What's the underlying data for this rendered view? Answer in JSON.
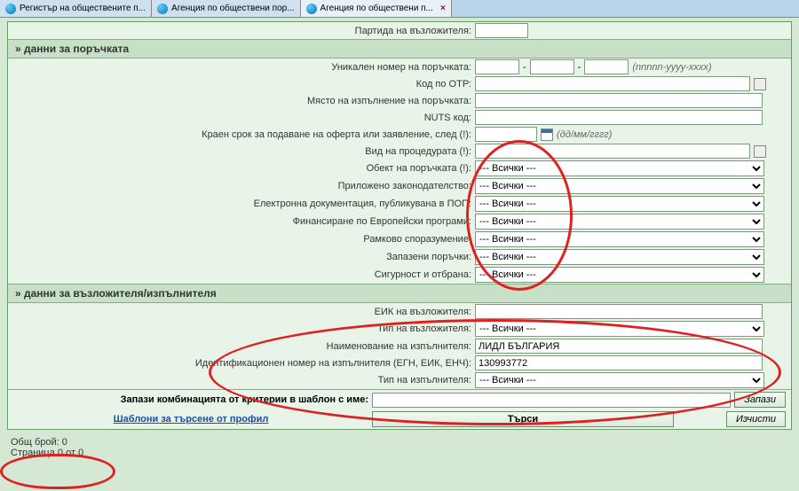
{
  "tabs": [
    {
      "label": "Регистър на обществените п..."
    },
    {
      "label": "Агенция по обществени пор..."
    },
    {
      "label": "Агенция по обществени п...",
      "active": true
    }
  ],
  "top": {
    "label_party": "Партида на възложителя:"
  },
  "section_order": "» данни за поръчката",
  "order": {
    "label_unique": "Уникален номер на поръчката:",
    "hint_unique": "(nnnnn-yyyy-xxxx)",
    "label_otp": "Код по ОТР:",
    "label_place": "Място на изпълнение на поръчката:",
    "label_nuts": "NUTS код:",
    "label_deadline": "Краен срок за подаване на оферта или заявление, след (!):",
    "hint_date": "(дд/мм/гггг)",
    "label_proc_type": "Вид на процедурата (!):",
    "label_object": "Обект на поръчката (!):",
    "label_legislation": "Приложено законодателство:",
    "label_edoc": "Електронна документация, публикувана в ПОП:",
    "label_eu_fin": "Финансиране по Европейски програми:",
    "label_framework": "Рамково споразумение:",
    "label_reserved": "Запазени поръчки:",
    "label_security": "Сигурност и отбрана:",
    "opt_all": "--- Всички ---"
  },
  "section_party": "» данни за възложителя/изпълнителя",
  "party": {
    "label_eik": "ЕИК на възложителя:",
    "label_type": "Тип на възложителя:",
    "label_exec_name": "Наименование на изпълнителя:",
    "exec_name_value": "ЛИДЛ БЪЛГАРИЯ",
    "label_exec_id": "Идентификационен номер на изпълнителя (ЕГН, ЕИК, ЕНЧ):",
    "exec_id_value": "130993772",
    "label_exec_type": "Тип на изпълнителя:",
    "opt_all": "--- Всички ---"
  },
  "template_save_label": "Запази комбинацията от критерии в шаблон с име:",
  "btn_save": "Запази",
  "link_templates": "Шаблони за търсене от профил",
  "btn_search": "Търси",
  "btn_clear": "Изчисти",
  "totals_count": "Общ брой: 0",
  "totals_page": "Страница 0 от 0"
}
